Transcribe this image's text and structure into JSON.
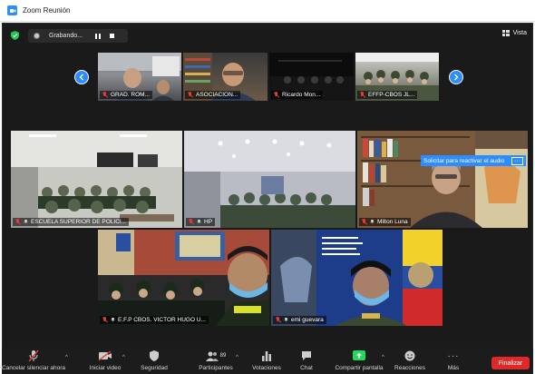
{
  "window": {
    "title": "Zoom Reunión"
  },
  "topbar": {
    "recording_label": "Grabando...",
    "view_label": "Vista"
  },
  "notification": {
    "text": "Solicitar para reactivar el audio",
    "more": "···"
  },
  "participants_top": [
    {
      "name": "GRAD. ROM..."
    },
    {
      "name": "ASOCIACIÓN..."
    },
    {
      "name": "Ricardo Mon..."
    },
    {
      "name": "EFFP-CBOS JL..."
    }
  ],
  "participants_mid": [
    {
      "name": "ESCUELA SUPERIOR DE POLICI..."
    },
    {
      "name": "HP"
    },
    {
      "name": "Milton Luna"
    }
  ],
  "participants_bottom": [
    {
      "name": "E.F.P CBOS. VICTOR HUGO U..."
    },
    {
      "name": "emi guevara"
    }
  ],
  "toolbar": {
    "items": [
      {
        "label": "Cancelar silenciar ahora",
        "icon": "mic-muted-icon"
      },
      {
        "label": "Iniciar video",
        "icon": "video-off-icon"
      },
      {
        "label": "Seguridad",
        "icon": "shield-icon"
      },
      {
        "label": "Participantes",
        "icon": "participants-icon",
        "count": "89"
      },
      {
        "label": "Votaciones",
        "icon": "polls-icon"
      },
      {
        "label": "Chat",
        "icon": "chat-icon"
      },
      {
        "label": "Compartir pantalla",
        "icon": "share-screen-icon"
      },
      {
        "label": "Reacciones",
        "icon": "reactions-icon"
      },
      {
        "label": "Más",
        "icon": "more-icon",
        "glyph": "···"
      }
    ],
    "end_label": "Finalizar"
  },
  "colors": {
    "accent": "#2d8cff",
    "end": "#e02828",
    "share": "#23d959",
    "background": "#1a1a1a"
  }
}
